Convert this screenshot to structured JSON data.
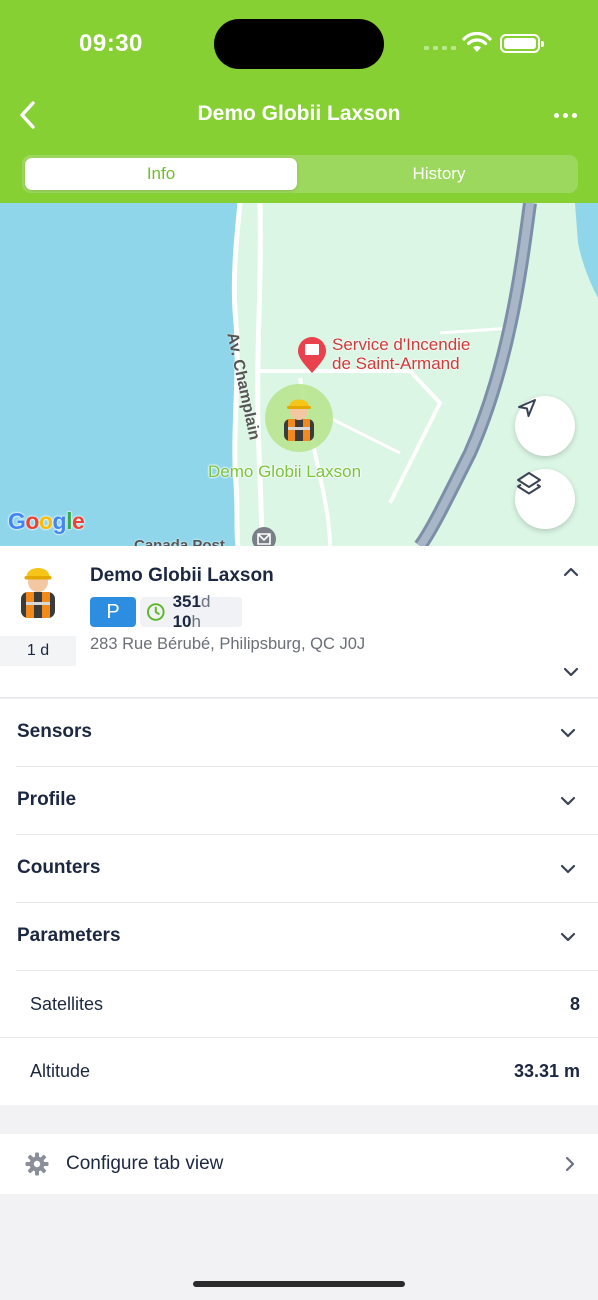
{
  "status_bar": {
    "time": "09:30"
  },
  "header": {
    "title": "Demo Globii Laxson",
    "tabs": [
      {
        "label": "Info",
        "active": true
      },
      {
        "label": "History",
        "active": false
      }
    ],
    "colors": {
      "header_bg": "#86d034",
      "active_tab_text": "#6fbf2a"
    }
  },
  "map": {
    "provider_logo": "Google",
    "poi_line1": "Service d'Incendie",
    "poi_line2": "de Saint-Armand",
    "street_label": "Av. Champlain",
    "marker_label": "Demo Globii Laxson",
    "partial_label": "Canada Post",
    "buttons": [
      "locate-icon",
      "layers-icon"
    ]
  },
  "object": {
    "name": "Demo Globii Laxson",
    "duration": "1 d",
    "parking_badge": "P",
    "elapsed_days": "351",
    "elapsed_days_unit": "d",
    "elapsed_hours": "10",
    "elapsed_hours_unit": "h",
    "address": "283 Rue Bérubé, Philipsburg, QC J0J",
    "status_color": "#2d8de0"
  },
  "sections": [
    {
      "label": "Sensors"
    },
    {
      "label": "Profile"
    },
    {
      "label": "Counters"
    },
    {
      "label": "Parameters"
    }
  ],
  "parameters": [
    {
      "label": "Satellites",
      "value": "8"
    },
    {
      "label": "Altitude",
      "value": "33.31 m"
    }
  ],
  "configure": {
    "label": "Configure tab view"
  }
}
